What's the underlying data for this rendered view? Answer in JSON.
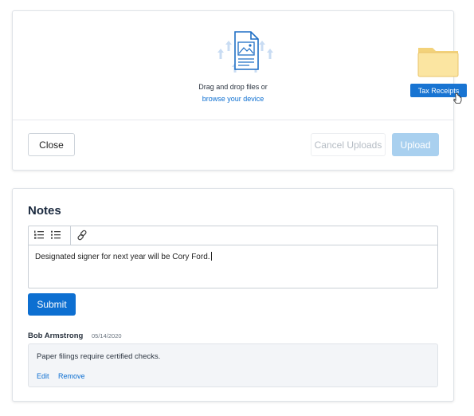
{
  "upload": {
    "drop_text": "Drag and drop files or",
    "browse_link": "browse your device",
    "close_label": "Close",
    "cancel_label": "Cancel Uploads",
    "upload_label": "Upload"
  },
  "drag_ghost": {
    "label": "Tax Receipts"
  },
  "notes": {
    "title": "Notes",
    "editor_text": "Designated signer for next year will be Cory Ford.",
    "submit_label": "Submit",
    "comments": [
      {
        "author": "Bob Armstrong",
        "date": "05/14/2020",
        "text": "Paper filings require certified checks.",
        "edit_label": "Edit",
        "remove_label": "Remove"
      }
    ]
  },
  "colors": {
    "primary": "#0d6fd1",
    "upload_disabled": "#a9d0ef",
    "folder": "#fbe5a1"
  },
  "icons": {
    "drop": "file-upload-icon",
    "folder": "folder-icon",
    "cursor": "pointer-cursor-icon",
    "ordered_list": "ordered-list-icon",
    "bullet_list": "bullet-list-icon",
    "link": "link-icon"
  }
}
